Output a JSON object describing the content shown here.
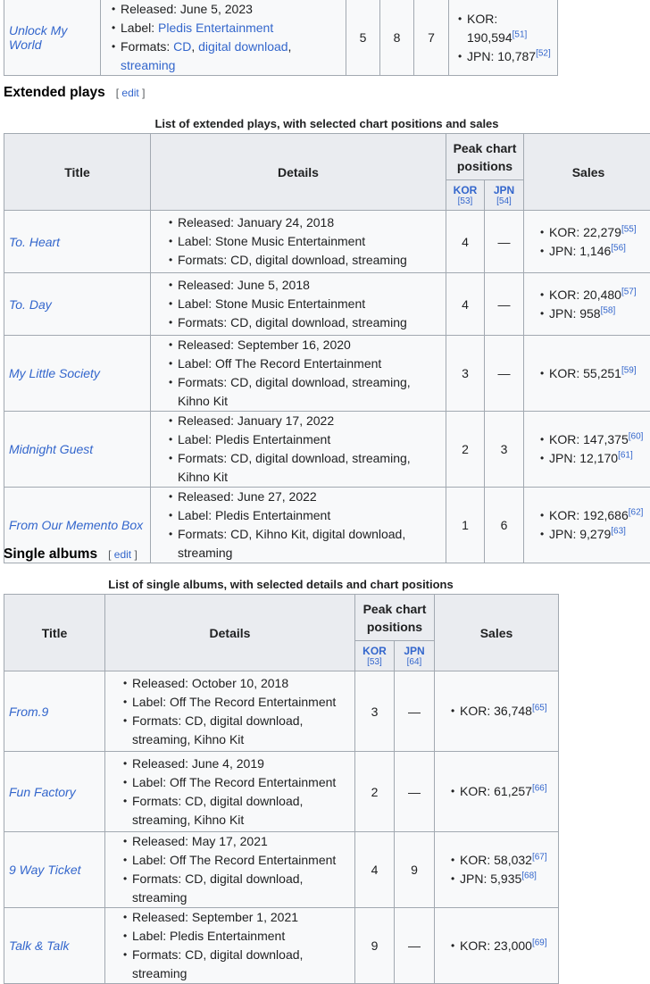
{
  "top_row": {
    "title": "Unlock My World",
    "released": "Released: June 5, 2023",
    "label_prefix": "Label: ",
    "label": "Pledis Entertainment",
    "formats_prefix": "Formats: ",
    "formats": [
      "CD",
      "digital download",
      "streaming"
    ],
    "kor": "5",
    "jpn": "8",
    "third": "7",
    "sales": [
      {
        "text": "KOR: 190,594",
        "ref": "[51]"
      },
      {
        "text": "JPN: 10,787",
        "ref": "[52]"
      }
    ]
  },
  "ep": {
    "heading": "Extended plays",
    "edit": "edit",
    "caption": "List of extended plays, with selected chart positions and sales",
    "headers": {
      "title": "Title",
      "details": "Details",
      "peak": "Peak chart positions",
      "kor": "KOR",
      "kor_ref": "[53]",
      "jpn": "JPN",
      "jpn_ref": "[54]",
      "sales": "Sales"
    },
    "rows": [
      {
        "title": "To. Heart",
        "released": "Released: January 24, 2018",
        "label": "Label: Stone Music Entertainment",
        "formats": "Formats: CD, digital download, streaming",
        "kor": "4",
        "jpn": "—",
        "sales": [
          {
            "text": "KOR: 22,279",
            "ref": "[55]"
          },
          {
            "text": "JPN: 1,146",
            "ref": "[56]"
          }
        ]
      },
      {
        "title": "To. Day",
        "released": "Released: June 5, 2018",
        "label": "Label: Stone Music Entertainment",
        "formats": "Formats: CD, digital download, streaming",
        "kor": "4",
        "jpn": "—",
        "sales": [
          {
            "text": "KOR: 20,480",
            "ref": "[57]"
          },
          {
            "text": "JPN: 958",
            "ref": "[58]"
          }
        ]
      },
      {
        "title": "My Little Society",
        "released": "Released: September 16, 2020",
        "label": "Label: Off The Record Entertainment",
        "formats": "Formats: CD, digital download, streaming, Kihno Kit",
        "kor": "3",
        "jpn": "—",
        "sales": [
          {
            "text": "KOR: 55,251",
            "ref": "[59]"
          }
        ]
      },
      {
        "title": "Midnight Guest",
        "released": "Released: January 17, 2022",
        "label": "Label: Pledis Entertainment",
        "formats": "Formats: CD, digital download, streaming, Kihno Kit",
        "kor": "2",
        "jpn": "3",
        "sales": [
          {
            "text": "KOR: 147,375",
            "ref": "[60]"
          },
          {
            "text": "JPN: 12,170",
            "ref": "[61]"
          }
        ]
      },
      {
        "title": "From Our Memento Box",
        "released": "Released: June 27, 2022",
        "label": "Label: Pledis Entertainment",
        "formats": "Formats: CD, Kihno Kit, digital download, streaming",
        "kor": "1",
        "jpn": "6",
        "sales": [
          {
            "text": "KOR: 192,686",
            "ref": "[62]"
          },
          {
            "text": "JPN: 9,279",
            "ref": "[63]"
          }
        ]
      }
    ]
  },
  "single": {
    "heading": "Single albums",
    "edit": "edit",
    "caption": "List of single albums, with selected details and chart positions",
    "headers": {
      "title": "Title",
      "details": "Details",
      "peak": "Peak chart positions",
      "kor": "KOR",
      "kor_ref": "[53]",
      "jpn": "JPN",
      "jpn_ref": "[64]",
      "sales": "Sales"
    },
    "rows": [
      {
        "title": "From.9",
        "released": "Released: October 10, 2018",
        "label": "Label: Off The Record Entertainment",
        "formats": "Formats: CD, digital download, streaming, Kihno Kit",
        "kor": "3",
        "jpn": "—",
        "sales": [
          {
            "text": "KOR: 36,748",
            "ref": "[65]"
          }
        ]
      },
      {
        "title": "Fun Factory",
        "released": "Released: June 4, 2019",
        "label": "Label: Off The Record Entertainment",
        "formats": "Formats: CD, digital download, streaming, Kihno Kit",
        "kor": "2",
        "jpn": "—",
        "sales": [
          {
            "text": "KOR: 61,257",
            "ref": "[66]"
          }
        ]
      },
      {
        "title": "9 Way Ticket",
        "released": "Released: May 17, 2021",
        "label": "Label: Off The Record Entertainment",
        "formats": "Formats: CD, digital download, streaming",
        "kor": "4",
        "jpn": "9",
        "sales": [
          {
            "text": "KOR: 58,032",
            "ref": "[67]"
          },
          {
            "text": "JPN: 5,935",
            "ref": "[68]"
          }
        ]
      },
      {
        "title": "Talk & Talk",
        "released": "Released: September 1, 2021",
        "label": "Label: Pledis Entertainment",
        "formats": "Formats: CD, digital download, streaming",
        "kor": "9",
        "jpn": "—",
        "sales": [
          {
            "text": "KOR: 23,000",
            "ref": "[69]"
          }
        ]
      }
    ]
  }
}
